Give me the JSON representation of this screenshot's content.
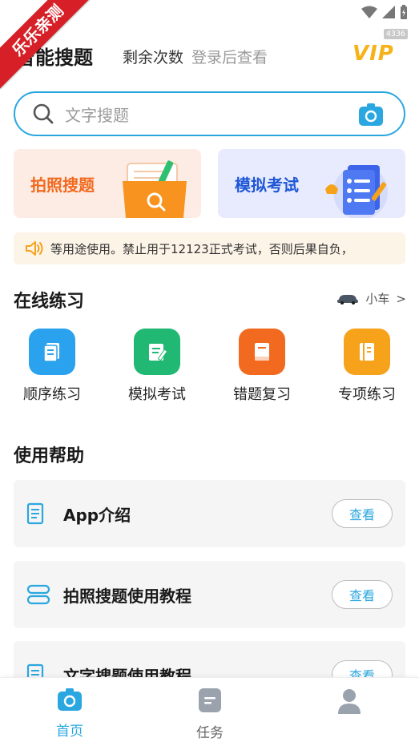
{
  "watermark": {
    "ribbon_text": "乐乐亲测",
    "build_badge": "4336"
  },
  "header": {
    "title": "智能搜题",
    "remaining_label": "剩余次数",
    "remaining_value": "登录后查看",
    "vip_label": "VIP"
  },
  "search": {
    "placeholder": "文字搜题",
    "camera_icon": "camera-icon"
  },
  "cards": [
    {
      "label": "拍照搜题",
      "icon": "folder-search-icon"
    },
    {
      "label": "模拟考试",
      "icon": "checklist-icon"
    }
  ],
  "notice": {
    "text": "等用途使用。禁止用于12123正式考试，否则后果自负，"
  },
  "practice_section": {
    "title": "在线练习",
    "vehicle_label": "小车",
    "vehicle_chevron": ">",
    "items": [
      {
        "label": "顺序练习",
        "color": "#2aa2ee",
        "icon": "sequence-doc-icon"
      },
      {
        "label": "模拟考试",
        "color": "#21b873",
        "icon": "edit-doc-icon"
      },
      {
        "label": "错题复习",
        "color": "#f26a1f",
        "icon": "book-icon"
      },
      {
        "label": "专项练习",
        "color": "#f7a21b",
        "icon": "notebook-icon"
      }
    ]
  },
  "help_section": {
    "title": "使用帮助",
    "items": [
      {
        "label": "App介绍",
        "button": "查看",
        "icon": "document-icon"
      },
      {
        "label": "拍照搜题使用教程",
        "button": "查看",
        "icon": "layers-icon"
      },
      {
        "label": "文字搜题使用教程",
        "button": "查看",
        "icon": "document-icon"
      }
    ]
  },
  "tabbar": {
    "tabs": [
      {
        "label": "首页",
        "active": true,
        "icon": "camera-icon"
      },
      {
        "label": "任务",
        "active": false,
        "icon": "task-icon"
      },
      {
        "label": "",
        "active": false,
        "icon": "profile-icon"
      }
    ]
  },
  "colors": {
    "accent": "#2aa7e0",
    "vip": "#f5b31a",
    "photo_card_bg": "#fdece4",
    "exam_card_bg": "#e7ebfd"
  }
}
